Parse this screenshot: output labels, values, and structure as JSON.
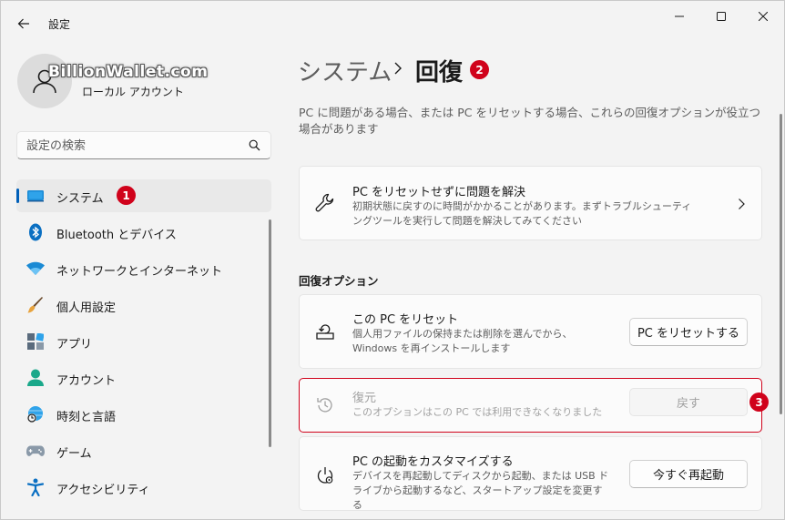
{
  "window": {
    "title": "設定"
  },
  "profile": {
    "watermark": "BillionWallet.com",
    "account_type": "ローカル アカウント"
  },
  "search": {
    "placeholder": "設定の検索"
  },
  "nav": {
    "items": [
      {
        "label": "システム",
        "icon": "system-icon",
        "active": true
      },
      {
        "label": "Bluetooth とデバイス",
        "icon": "bluetooth-icon"
      },
      {
        "label": "ネットワークとインターネット",
        "icon": "wifi-icon"
      },
      {
        "label": "個人用設定",
        "icon": "brush-icon"
      },
      {
        "label": "アプリ",
        "icon": "apps-icon"
      },
      {
        "label": "アカウント",
        "icon": "account-icon"
      },
      {
        "label": "時刻と言語",
        "icon": "globe-clock-icon"
      },
      {
        "label": "ゲーム",
        "icon": "gamepad-icon"
      },
      {
        "label": "アクセシビリティ",
        "icon": "accessibility-icon"
      }
    ]
  },
  "header": {
    "parent": "システム",
    "current": "回復"
  },
  "description": "PC に問題がある場合、または PC をリセットする場合、これらの回復オプションが役立つ場合があります",
  "troubleshoot_card": {
    "title": "PC をリセットせずに問題を解決",
    "subtitle": "初期状態に戻すのに時間がかかることがあります。まずトラブルシューティングツールを実行して問題を解決してみてください"
  },
  "section": {
    "label": "回復オプション"
  },
  "options": [
    {
      "title": "この PC をリセット",
      "subtitle": "個人用ファイルの保持または削除を選んでから、Windows を再インストールします",
      "button": "PC をリセットする",
      "icon": "reset-pc-icon"
    },
    {
      "title": "復元",
      "subtitle": "このオプションはこの PC では利用できなくなりました",
      "button": "戻す",
      "icon": "history-icon",
      "disabled": true
    },
    {
      "title": "PC の起動をカスタマイズする",
      "subtitle": "デバイスを再起動してディスクから起動、または USB ドライブから起動するなど、スタートアップ設定を変更する",
      "button": "今すぐ再起動",
      "icon": "advanced-startup-icon"
    }
  ],
  "annotations": {
    "step1": "1",
    "step2": "2",
    "step3": "3"
  },
  "colors": {
    "accent": "#005fb8",
    "annotation": "#d0021b",
    "highlight_border": "#d0021b"
  }
}
